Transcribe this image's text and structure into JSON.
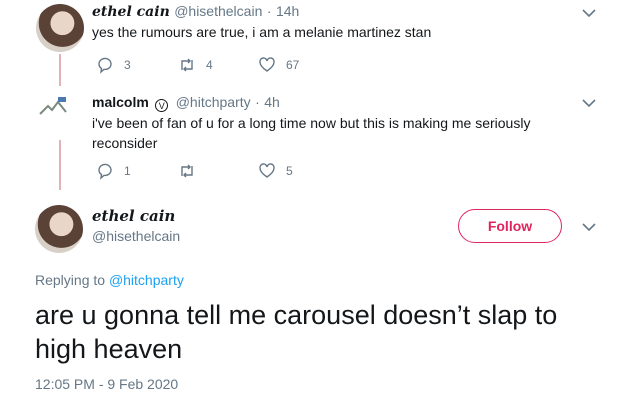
{
  "tweets": [
    {
      "name": "ethel cain",
      "handle": "@hisethelcain",
      "time": "14h",
      "text": "yes the rumours are true, i am a melanie martinez stan",
      "replies": "3",
      "retweets": "4",
      "likes": "67"
    },
    {
      "name": "malcolm",
      "verified_glyph": "V",
      "handle": "@hitchparty",
      "time": "4h",
      "text": "i've been of fan of u for a long time now but this is making me seriously reconsider",
      "replies": "1",
      "retweets": "",
      "likes": "5"
    }
  ],
  "main_tweet": {
    "name": "ethel cain",
    "handle": "@hisethelcain",
    "follow_label": "Follow",
    "replying_prefix": "Replying to",
    "replying_to": "@hitchparty",
    "text": "are u gonna tell me carousel doesn’t slap to high heaven",
    "timestamp": "12:05 PM - 9 Feb 2020"
  },
  "colors": {
    "accent": "#e0245e",
    "link": "#1da1f2",
    "muted": "#657786",
    "thread_line": "#e1b3b9"
  },
  "icons": [
    "reply-icon",
    "retweet-icon",
    "like-icon",
    "chevron-down-icon",
    "verified-icon"
  ]
}
